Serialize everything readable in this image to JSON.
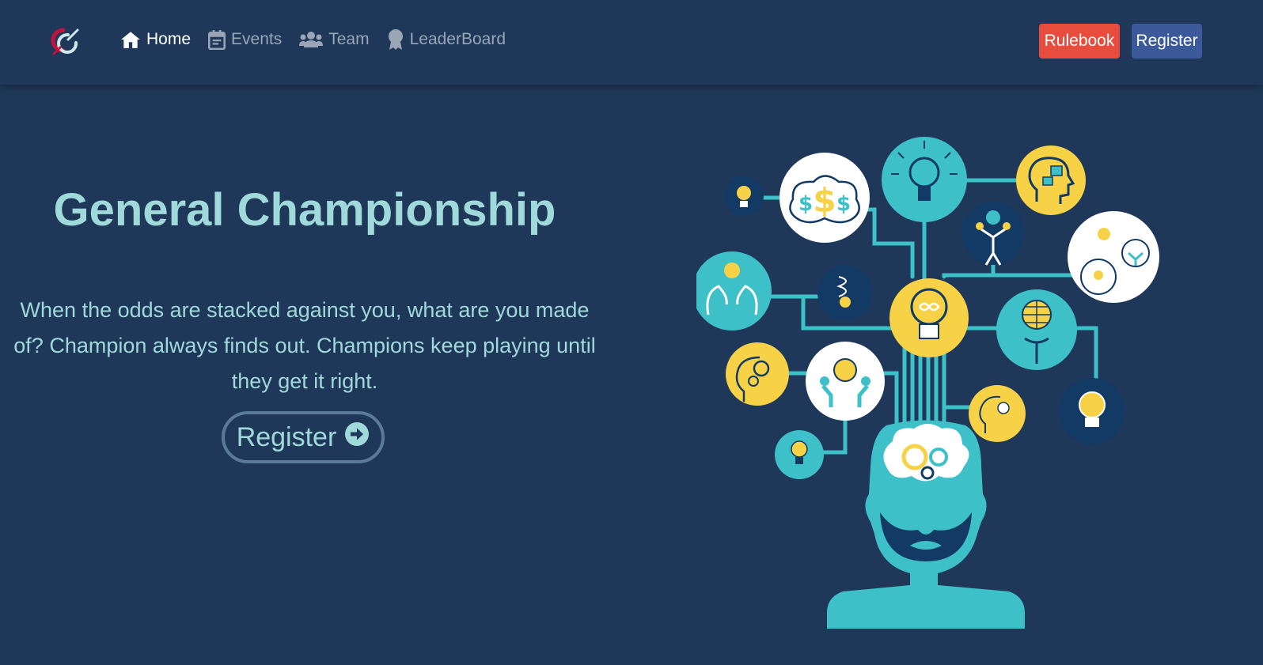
{
  "navbar": {
    "logo_icon": "brand-logo",
    "items": [
      {
        "label": "Home",
        "icon": "home-icon",
        "active": true
      },
      {
        "label": "Events",
        "icon": "calendar-icon",
        "active": false
      },
      {
        "label": "Team",
        "icon": "users-icon",
        "active": false
      },
      {
        "label": "LeaderBoard",
        "icon": "award-icon",
        "active": false
      }
    ],
    "rulebook_label": "Rulebook",
    "register_label": "Register"
  },
  "hero": {
    "title": "General Championship",
    "description": "When the odds are stacked against you, what are you made of? Champion always finds out. Champions keep playing until they get it right.",
    "register_label": "Register",
    "register_icon": "arrow-circle-right-icon"
  },
  "illustration": {
    "subject": "head-with-idea-bulbs-tree"
  },
  "colors": {
    "background": "#1f3859",
    "accent_text": "#9fd9d9",
    "rulebook": "#e74c3c",
    "register": "#3c5a99",
    "teal": "#3ec0c8",
    "yellow": "#f7d246",
    "navy": "#123a64"
  }
}
